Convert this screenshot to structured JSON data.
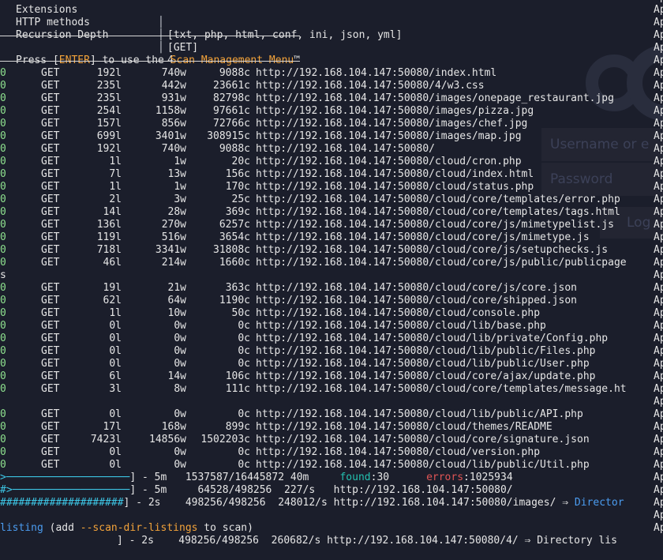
{
  "header": {
    "rows": [
      {
        "label": "Extensions",
        "value": "[txt, php, html, conf, ini, json, yml]"
      },
      {
        "label": "HTTP methods",
        "value": "[GET]"
      },
      {
        "label": "Recursion Depth",
        "value": "4"
      }
    ],
    "press_prefix": "Press [",
    "press_key": "ENTER",
    "press_mid": "] to use the ",
    "press_menu": "Scan Management Menu",
    "press_suffix": "™"
  },
  "results": [
    {
      "status": "0",
      "method": "GET",
      "lines": "192l",
      "words": "740w",
      "chars": "9088c",
      "url": "http://192.168.104.147:50080/index.html"
    },
    {
      "status": "0",
      "method": "GET",
      "lines": "235l",
      "words": "442w",
      "chars": "23661c",
      "url": "http://192.168.104.147:50080/4/w3.css"
    },
    {
      "status": "0",
      "method": "GET",
      "lines": "235l",
      "words": "931w",
      "chars": "82798c",
      "url": "http://192.168.104.147:50080/images/onepage_restaurant.jpg"
    },
    {
      "status": "0",
      "method": "GET",
      "lines": "254l",
      "words": "1158w",
      "chars": "97661c",
      "url": "http://192.168.104.147:50080/images/pizza.jpg"
    },
    {
      "status": "0",
      "method": "GET",
      "lines": "157l",
      "words": "856w",
      "chars": "72766c",
      "url": "http://192.168.104.147:50080/images/chef.jpg"
    },
    {
      "status": "0",
      "method": "GET",
      "lines": "699l",
      "words": "3401w",
      "chars": "308915c",
      "url": "http://192.168.104.147:50080/images/map.jpg"
    },
    {
      "status": "0",
      "method": "GET",
      "lines": "192l",
      "words": "740w",
      "chars": "9088c",
      "url": "http://192.168.104.147:50080/"
    },
    {
      "status": "0",
      "method": "GET",
      "lines": "1l",
      "words": "1w",
      "chars": "20c",
      "url": "http://192.168.104.147:50080/cloud/cron.php"
    },
    {
      "status": "0",
      "method": "GET",
      "lines": "7l",
      "words": "13w",
      "chars": "156c",
      "url": "http://192.168.104.147:50080/cloud/index.html"
    },
    {
      "status": "0",
      "method": "GET",
      "lines": "1l",
      "words": "1w",
      "chars": "170c",
      "url": "http://192.168.104.147:50080/cloud/status.php"
    },
    {
      "status": "0",
      "method": "GET",
      "lines": "2l",
      "words": "3w",
      "chars": "25c",
      "url": "http://192.168.104.147:50080/cloud/core/templates/error.php"
    },
    {
      "status": "0",
      "method": "GET",
      "lines": "14l",
      "words": "28w",
      "chars": "369c",
      "url": "http://192.168.104.147:50080/cloud/core/templates/tags.html"
    },
    {
      "status": "0",
      "method": "GET",
      "lines": "136l",
      "words": "270w",
      "chars": "6257c",
      "url": "http://192.168.104.147:50080/cloud/core/js/mimetypelist.js"
    },
    {
      "status": "0",
      "method": "GET",
      "lines": "119l",
      "words": "516w",
      "chars": "3654c",
      "url": "http://192.168.104.147:50080/cloud/core/js/mimetype.js"
    },
    {
      "status": "0",
      "method": "GET",
      "lines": "718l",
      "words": "3341w",
      "chars": "31808c",
      "url": "http://192.168.104.147:50080/cloud/core/js/setupchecks.js"
    },
    {
      "status": "0",
      "method": "GET",
      "lines": "46l",
      "words": "214w",
      "chars": "1660c",
      "url": "http://192.168.104.147:50080/cloud/core/js/public/publicpage"
    },
    {
      "stray": "s"
    },
    {
      "status": "0",
      "method": "GET",
      "lines": "19l",
      "words": "21w",
      "chars": "363c",
      "url": "http://192.168.104.147:50080/cloud/core/js/core.json"
    },
    {
      "status": "0",
      "method": "GET",
      "lines": "62l",
      "words": "64w",
      "chars": "1190c",
      "url": "http://192.168.104.147:50080/cloud/core/shipped.json"
    },
    {
      "status": "0",
      "method": "GET",
      "lines": "1l",
      "words": "10w",
      "chars": "50c",
      "url": "http://192.168.104.147:50080/cloud/console.php"
    },
    {
      "status": "0",
      "method": "GET",
      "lines": "0l",
      "words": "0w",
      "chars": "0c",
      "url": "http://192.168.104.147:50080/cloud/lib/base.php"
    },
    {
      "status": "0",
      "method": "GET",
      "lines": "0l",
      "words": "0w",
      "chars": "0c",
      "url": "http://192.168.104.147:50080/cloud/lib/private/Config.php"
    },
    {
      "status": "0",
      "method": "GET",
      "lines": "0l",
      "words": "0w",
      "chars": "0c",
      "url": "http://192.168.104.147:50080/cloud/lib/public/Files.php"
    },
    {
      "status": "0",
      "method": "GET",
      "lines": "0l",
      "words": "0w",
      "chars": "0c",
      "url": "http://192.168.104.147:50080/cloud/lib/public/User.php"
    },
    {
      "status": "0",
      "method": "GET",
      "lines": "6l",
      "words": "14w",
      "chars": "106c",
      "url": "http://192.168.104.147:50080/cloud/core/ajax/update.php"
    },
    {
      "status": "0",
      "method": "GET",
      "lines": "3l",
      "words": "8w",
      "chars": "111c",
      "url": "http://192.168.104.147:50080/cloud/core/templates/message.ht"
    },
    {
      "stray": ""
    },
    {
      "status": "0",
      "method": "GET",
      "lines": "0l",
      "words": "0w",
      "chars": "0c",
      "url": "http://192.168.104.147:50080/cloud/lib/public/API.php"
    },
    {
      "status": "0",
      "method": "GET",
      "lines": "17l",
      "words": "168w",
      "chars": "899c",
      "url": "http://192.168.104.147:50080/cloud/themes/README"
    },
    {
      "status": "0",
      "method": "GET",
      "lines": "7423l",
      "words": "14856w",
      "chars": "1502203c",
      "url": "http://192.168.104.147:50080/cloud/core/signature.json"
    },
    {
      "status": "0",
      "method": "GET",
      "lines": "0l",
      "words": "0w",
      "chars": "0c",
      "url": "http://192.168.104.147:50080/cloud/version.php"
    },
    {
      "status": "0",
      "method": "GET",
      "lines": "0l",
      "words": "0w",
      "chars": "0c",
      "url": "http://192.168.104.147:50080/cloud/lib/public/Util.php"
    }
  ],
  "right_col": "Ap",
  "progress": [
    {
      "bar": ">────────────────────",
      "text": "] - 5m   1537587/16445872 40m     ",
      "found_label": "found",
      "found_value": ":30",
      "gap": "      ",
      "errors_label": "errors",
      "errors_value": ":1025934"
    },
    {
      "bar": "#>───────────────────",
      "text": "] - 5m     64528/498256  227/s   http://192.168.104.147:50080/"
    },
    {
      "bar": "####################",
      "text": "] - 2s    498256/498256  248012/s http://192.168.104.147:50080/images/ ⇒ ",
      "suffix": "Director"
    }
  ],
  "footer": {
    "prefix": "listing",
    "mid": " (add ",
    "flag": "--scan-dir-listings",
    "suffix": " to scan)",
    "partial": "] - 2s    498256/498256  260682/s http://192.168.104.147:50080/4/ ⇒ Directory lis"
  },
  "watermark": {
    "username": "Username or e",
    "password": "Password",
    "login": "Log"
  }
}
